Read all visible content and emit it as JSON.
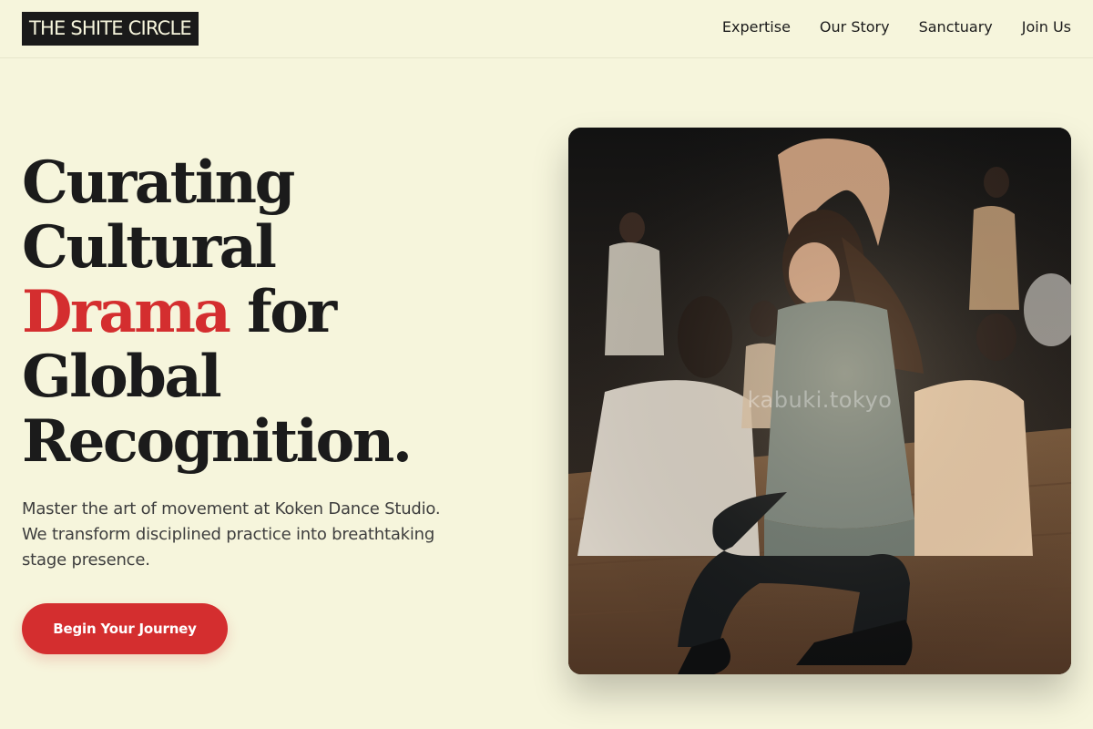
{
  "header": {
    "logo": "THE SHITE CIRCLE",
    "nav": [
      "Expertise",
      "Our Story",
      "Sanctuary",
      "Join Us"
    ]
  },
  "hero": {
    "title_line1": "Curating",
    "title_line2": "Cultural",
    "title_accent": "Drama",
    "title_line3_rest": " for",
    "title_line4": "Global",
    "title_line5": "Recognition.",
    "subtitle": "Master the art of movement at Koken Dance Studio. We transform disciplined practice into breathtaking stage presence.",
    "cta_label": "Begin Your Journey",
    "image_watermark": "kabuki.tokyo",
    "image_subject": "dance-studio-photo"
  },
  "colors": {
    "background": "#f6f5dc",
    "text": "#1b1b1b",
    "accent": "#d42e2f",
    "logo_bg": "#1a1a1a"
  }
}
